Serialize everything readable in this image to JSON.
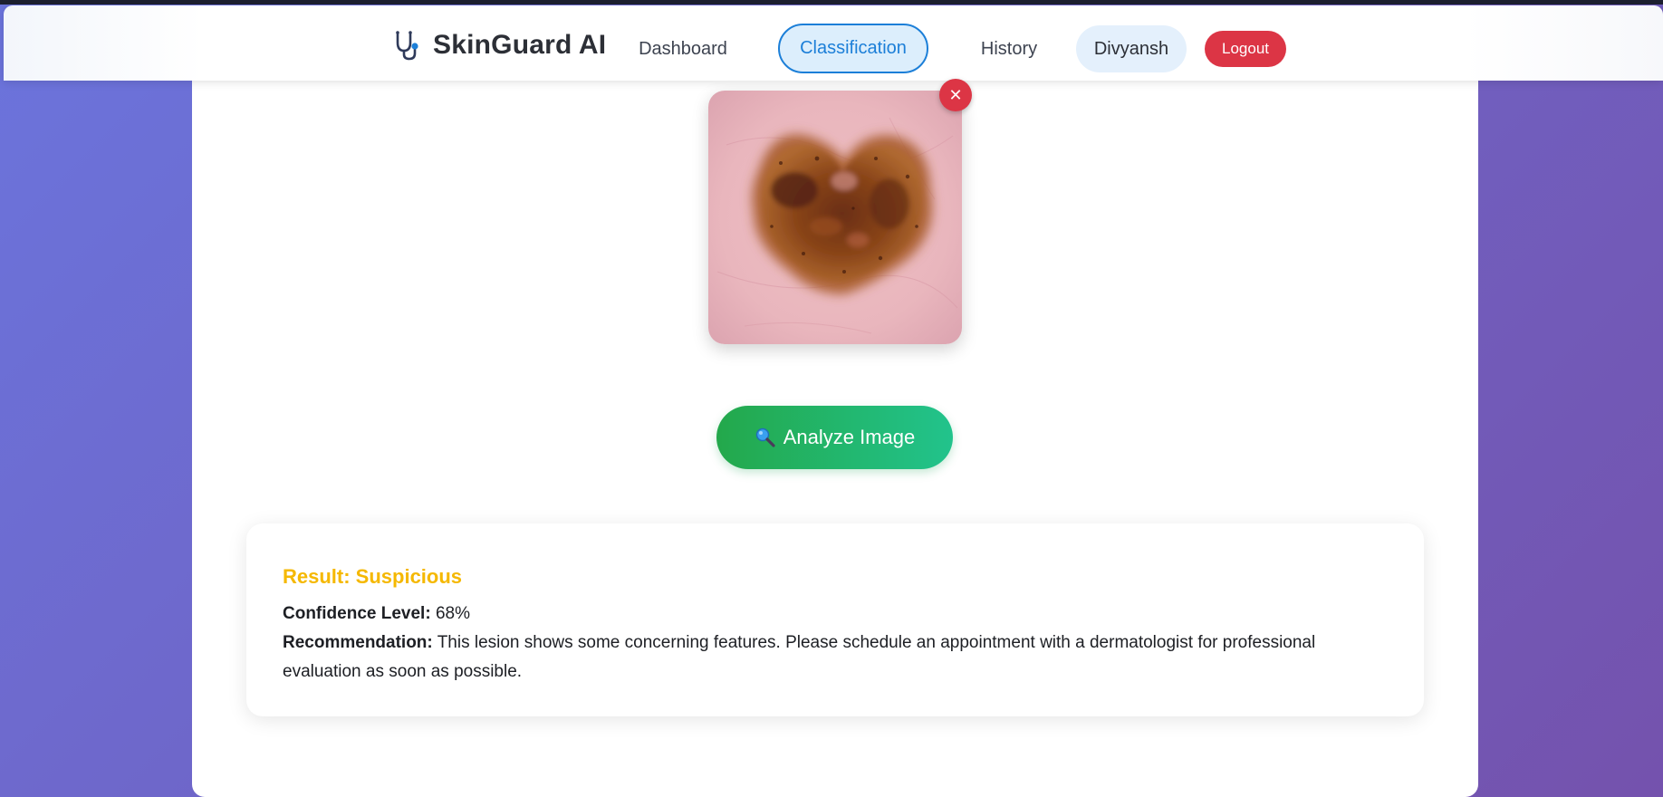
{
  "app": {
    "brand": "SkinGuard AI",
    "brand_icon": "stethoscope-icon"
  },
  "nav": {
    "dashboard": "Dashboard",
    "classification": "Classification",
    "history": "History",
    "user": "Divyansh",
    "logout": "Logout",
    "active_tab": "Classification"
  },
  "upload": {
    "remove_icon": "close-icon",
    "remove_symbol": "✕"
  },
  "analyze": {
    "label": "Analyze Image",
    "icon": "magnifier-icon"
  },
  "result": {
    "title": "Result: Suspicious",
    "confidence_label": "Confidence Level:",
    "confidence_value": "68%",
    "recommendation_label": "Recommendation:",
    "recommendation_text": "This lesion shows some concerning features. Please schedule an appointment with a dermatologist for professional evaluation as soon as possible."
  },
  "colors": {
    "accent_blue": "#1c7fd8",
    "danger_red": "#dc3545",
    "success_green": "#23a84b",
    "warning_yellow": "#f5b800",
    "background_start": "#6b74dc",
    "background_end": "#7452ad"
  }
}
